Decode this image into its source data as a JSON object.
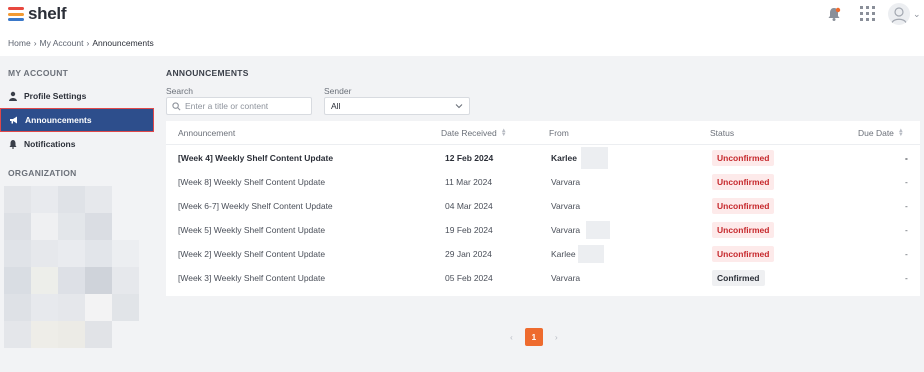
{
  "app": {
    "logo_text": "shelf",
    "logo_colors": [
      "#e8483f",
      "#f29a33",
      "#3a78c9"
    ]
  },
  "breadcrumb": {
    "items": [
      "Home",
      "My Account",
      "Announcements"
    ],
    "separator": "›"
  },
  "sidebar": {
    "my_account_title": "MY ACCOUNT",
    "items": [
      {
        "label": "Profile Settings",
        "icon": "user-icon"
      },
      {
        "label": "Announcements",
        "icon": "megaphone-icon",
        "active": true
      },
      {
        "label": "Notifications",
        "icon": "bell-icon"
      }
    ],
    "organization_title": "ORGANIZATION"
  },
  "main": {
    "title": "ANNOUNCEMENTS",
    "search_label": "Search",
    "search_placeholder": "Enter a title or content",
    "sender_label": "Sender",
    "sender_value": "All"
  },
  "table": {
    "headers": [
      "Announcement",
      "Date Received",
      "From",
      "Status",
      "Due Date"
    ],
    "rows": [
      {
        "title": "[Week 4] Weekly Shelf Content Update",
        "date": "12 Feb 2024",
        "from": "Karlee",
        "status": "Unconfirmed",
        "due": "-",
        "bold": true
      },
      {
        "title": "[Week 8] Weekly Shelf Content Update",
        "date": "11 Mar 2024",
        "from": "Varvara",
        "status": "Unconfirmed",
        "due": "-"
      },
      {
        "title": "[Week 6-7] Weekly Shelf Content Update",
        "date": "04 Mar 2024",
        "from": "Varvara",
        "status": "Unconfirmed",
        "due": "-"
      },
      {
        "title": "[Week 5] Weekly Shelf Content Update",
        "date": "19 Feb 2024",
        "from": "Varvara",
        "status": "Unconfirmed",
        "due": "-"
      },
      {
        "title": "[Week 2] Weekly Shelf Content Update",
        "date": "29 Jan 2024",
        "from": "Karlee",
        "status": "Unconfirmed",
        "due": "-"
      },
      {
        "title": "[Week 3] Weekly Shelf Content Update",
        "date": "05 Feb 2024",
        "from": "Varvara",
        "status": "Confirmed",
        "due": "-"
      }
    ]
  },
  "pagination": {
    "current": "1",
    "prev": "‹",
    "next": "›"
  },
  "colors": {
    "accent": "#2d4e8c",
    "page_active": "#ee6b2e",
    "unconfirmed": "#c6282c"
  }
}
